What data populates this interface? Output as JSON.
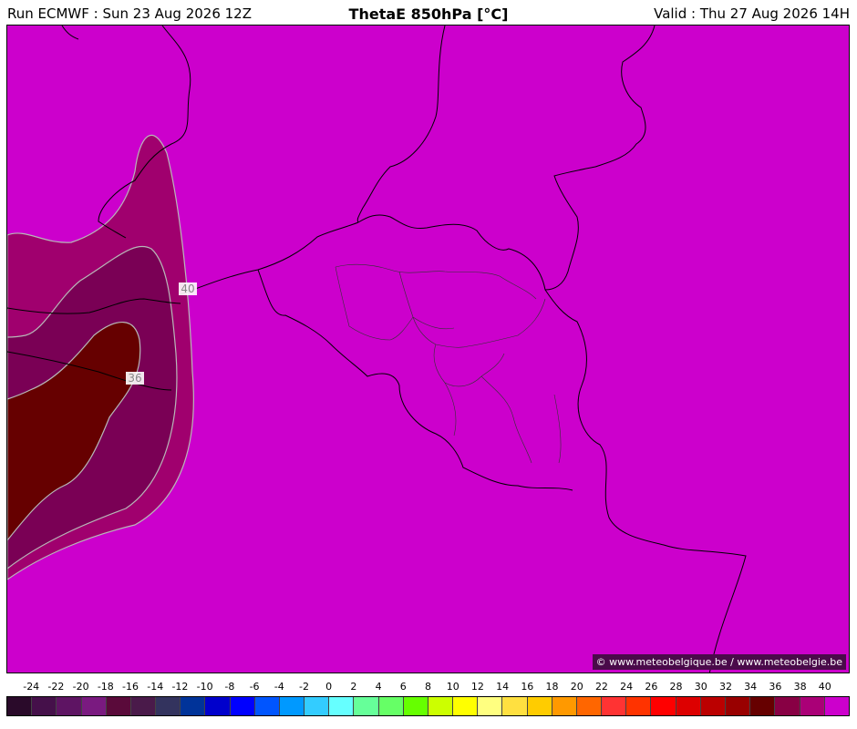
{
  "header": {
    "run": "Run ECMWF : Sun 23 Aug 2026 12Z",
    "title": "ThetaE 850hPa [°C]",
    "valid": "Valid : Thu 27 Aug 2026 14H"
  },
  "map": {
    "background_color": "#cc00cc",
    "copyright": "© www.meteobelgique.be / www.meteobelgie.be",
    "contour_labels": [
      "40",
      "36"
    ]
  },
  "legend": {
    "labels": [
      "-24",
      "-22",
      "-20",
      "-18",
      "-16",
      "-14",
      "-12",
      "-10",
      "-8",
      "-6",
      "-4",
      "-2",
      "0",
      "2",
      "4",
      "6",
      "8",
      "10",
      "12",
      "14",
      "16",
      "18",
      "20",
      "22",
      "24",
      "26",
      "28",
      "30",
      "32",
      "34",
      "36",
      "38",
      "40"
    ],
    "colors": [
      "#2a0a2a",
      "#45104a",
      "#5e1463",
      "#7a1a80",
      "#5a0a3a",
      "#4a1a4a",
      "#33335e",
      "#003399",
      "#0000cc",
      "#0000ff",
      "#0055ff",
      "#0099ff",
      "#33ccff",
      "#66ffff",
      "#66ff99",
      "#66ff66",
      "#66ff00",
      "#ccff00",
      "#ffff00",
      "#ffff80",
      "#ffe040",
      "#ffcc00",
      "#ff9900",
      "#ff6600",
      "#ff3333",
      "#ff3300",
      "#ff0000",
      "#dd0000",
      "#bb0000",
      "#990000",
      "#660000",
      "#880044",
      "#aa0077",
      "#cc00cc"
    ]
  }
}
